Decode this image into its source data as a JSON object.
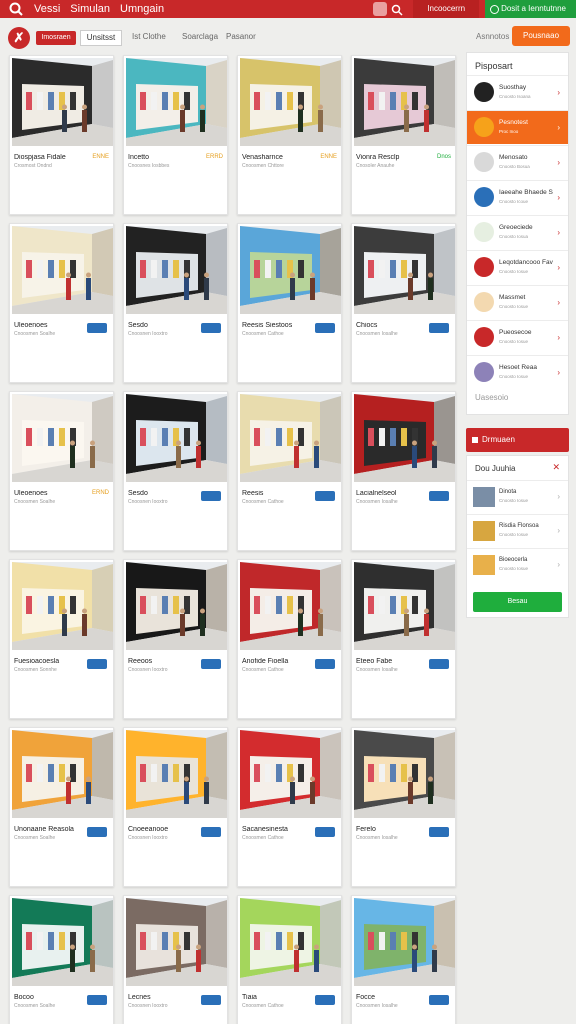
{
  "header": {
    "nav": [
      "Vessi",
      "Simulan",
      "Umngain"
    ],
    "login_label": "Incoocerrn",
    "cta_label": "Dosit a Ienntutnne",
    "colors": {
      "brand": "#c82829",
      "cta": "#1f9e3d",
      "accent": "#f26a1b"
    }
  },
  "subnav": {
    "logo_glyph": "✗",
    "pill_red": "Imosraen",
    "pill_white": "Unsitsst",
    "links": [
      "Ist Clothe",
      "Soarclaga",
      "Pasanor"
    ],
    "sort_label": "Asnnotos",
    "filter_label": "Pousnaao"
  },
  "cards": [
    {
      "title": "Diospjasa Fidale",
      "sub": "Crosmost Ondnd",
      "tag": "ENNE"
    },
    {
      "title": "Incetto",
      "sub": "Cnoosnes Iosbbes",
      "tag": "ERRD"
    },
    {
      "title": "Venasharnce",
      "sub": "Cnoosmen Chttore",
      "tag": "ENNE"
    },
    {
      "title": "Vionra Resclp",
      "sub": "Cnosoler Anauhe",
      "tag": "Dnos"
    },
    {
      "title": "Uleoenoes",
      "sub": "Cnoosmen Soalhe",
      "tag": ""
    },
    {
      "title": "Sesdo",
      "sub": "Cnoosnen Iooxtro",
      "tag": ""
    },
    {
      "title": "Reesis Siestoos",
      "sub": "Cnoosmen Cathoe",
      "tag": ""
    },
    {
      "title": "Chiocs",
      "sub": "Cnoosmen Iosalhe",
      "tag": ""
    },
    {
      "title": "Uleoenoes",
      "sub": "Cnoosmen Soalhe",
      "tag": "ERND"
    },
    {
      "title": "Sesdo",
      "sub": "Cnoosnen Iooxtro",
      "tag": ""
    },
    {
      "title": "Reesis",
      "sub": "Cnoosmen Cathoe",
      "tag": ""
    },
    {
      "title": "Lacialnelseol",
      "sub": "Cnoosmen Iosalhe",
      "tag": ""
    },
    {
      "title": "Fuesioacoesla",
      "sub": "Cnoosmen Sonnhe",
      "tag": ""
    },
    {
      "title": "Reeoos",
      "sub": "Cnoosnen Iooxtro",
      "tag": ""
    },
    {
      "title": "Anofide Fioella",
      "sub": "Cnoosmen Cathoe",
      "tag": ""
    },
    {
      "title": "Eteeo Fabe",
      "sub": "Cnoosmen Iosalhe",
      "tag": ""
    },
    {
      "title": "Unonaane Reasola",
      "sub": "Cnoosmen Soalhe",
      "tag": ""
    },
    {
      "title": "Cnoeeanooe",
      "sub": "Cnoosnen Iooxtro",
      "tag": ""
    },
    {
      "title": "Sacanesinesta",
      "sub": "Cnoosmen Cathoe",
      "tag": ""
    },
    {
      "title": "Ferelo",
      "sub": "Cnoosmen Iosalhe",
      "tag": ""
    },
    {
      "title": "Bocoo",
      "sub": "Cnoosmen Soalhe",
      "tag": ""
    },
    {
      "title": "Lecnes",
      "sub": "Cnoosnen Iooxtro",
      "tag": ""
    },
    {
      "title": "Tiaia",
      "sub": "Cnoosmen Cathoe",
      "tag": ""
    },
    {
      "title": "Focce",
      "sub": "Cnoosmen Iosalhe",
      "tag": ""
    }
  ],
  "sidebar": {
    "title": "Pisposart",
    "items": [
      {
        "t1": "Suosthay",
        "t2": "Cnoosto Isoana"
      },
      {
        "t1": "Pesnotest",
        "t2": "Proc Inoo"
      },
      {
        "t1": "Menosato",
        "t2": "Cnoosto Bosua"
      },
      {
        "t1": "Iaeeahe Bhaede Sushas lasa",
        "t2": "Cnoosto Icoue"
      },
      {
        "t1": "Greoeciede",
        "t2": "Cnoosto Iosua"
      },
      {
        "t1": "Leqotdancooo Favoele Drseod",
        "t2": "Cnoosto Iosue"
      },
      {
        "t1": "Massmet",
        "t2": "Cnoosto Iosue"
      },
      {
        "t1": "Pueosecoe",
        "t2": "Cnoosto Iosue"
      },
      {
        "t1": "Hesoet Reaa",
        "t2": "Cnoosto Iosue"
      }
    ],
    "footer": "Uasesoio"
  },
  "panel": {
    "header": "Drmuaen",
    "title": "Dou Juuhia",
    "items": [
      {
        "t1": "Dinota",
        "t2": "Cnoosto Iosue"
      },
      {
        "t1": "Risdia Flonsoa",
        "t2": "Cnoosto Iosue"
      },
      {
        "t1": "Bioeocerla",
        "t2": "Cnoosto Iosue"
      }
    ],
    "button": "Besau"
  }
}
